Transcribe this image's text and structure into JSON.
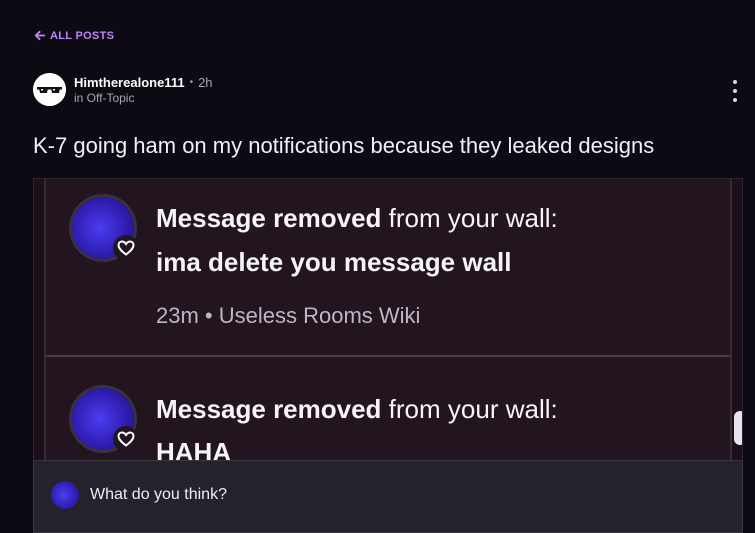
{
  "nav": {
    "back_label": "ALL POSTS"
  },
  "post": {
    "author": "Himtherealone111",
    "separator": "•",
    "time": "2h",
    "category": "in Off-Topic",
    "title": "K-7 going ham on my notifications because they leaked designs"
  },
  "image": {
    "notifications": [
      {
        "bold": "Message removed",
        "rest": " from your wall:",
        "message": "ima delete you message wall",
        "meta": "23m • Useless Rooms Wiki"
      },
      {
        "bold": "Message removed",
        "rest": " from your wall:",
        "message": "HAHA"
      }
    ]
  },
  "comment": {
    "placeholder": "What do you think?"
  },
  "colors": {
    "accent": "#c084fc",
    "background": "#0d0a14"
  }
}
